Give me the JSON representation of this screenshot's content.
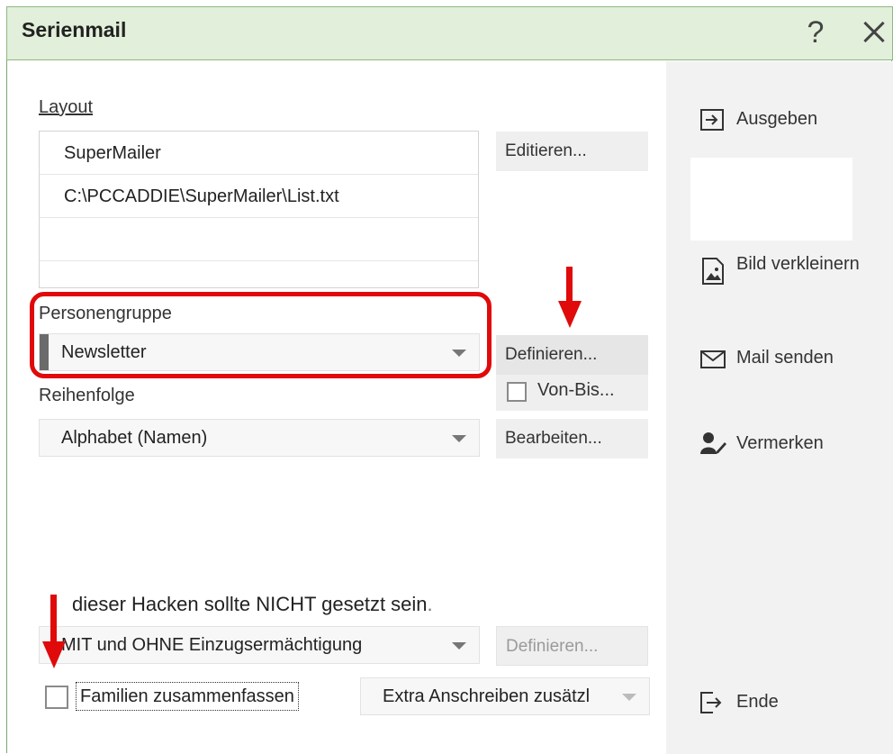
{
  "window": {
    "title": "Serienmail",
    "help_symbol": "?"
  },
  "layout": {
    "label": "Layout",
    "items": [
      "SuperMailer",
      "C:\\PCCADDIE\\SuperMailer\\List.txt"
    ],
    "edit_button": "Editieren..."
  },
  "personengruppe": {
    "label": "Personengruppe",
    "value": "Newsletter",
    "define_button": "Definieren...",
    "von_bis_label": "Von-Bis..."
  },
  "reihenfolge": {
    "label": "Reihenfolge",
    "value": "Alphabet (Namen)",
    "edit_button": "Bearbeiten..."
  },
  "annotation": {
    "text": "dieser Hacken sollte NICHT gesetzt sein",
    "color": "#e00a0a"
  },
  "einzug": {
    "value": "MIT und OHNE Einzugsermächtigung",
    "define_button": "Definieren..."
  },
  "familien": {
    "label": "Familien zusammenfassen",
    "checked": false,
    "extra_value": "Extra Anschreiben zusätzl"
  },
  "sidebar": {
    "ausgeben": "Ausgeben",
    "bild_verkleinern": "Bild verkleinern",
    "mail_senden": "Mail senden",
    "vermerken": "Vermerken",
    "ende": "Ende"
  },
  "colors": {
    "title_bar": "#e2efda",
    "sidebar": "#f2f2f2",
    "highlight_red": "#e00a0a"
  }
}
